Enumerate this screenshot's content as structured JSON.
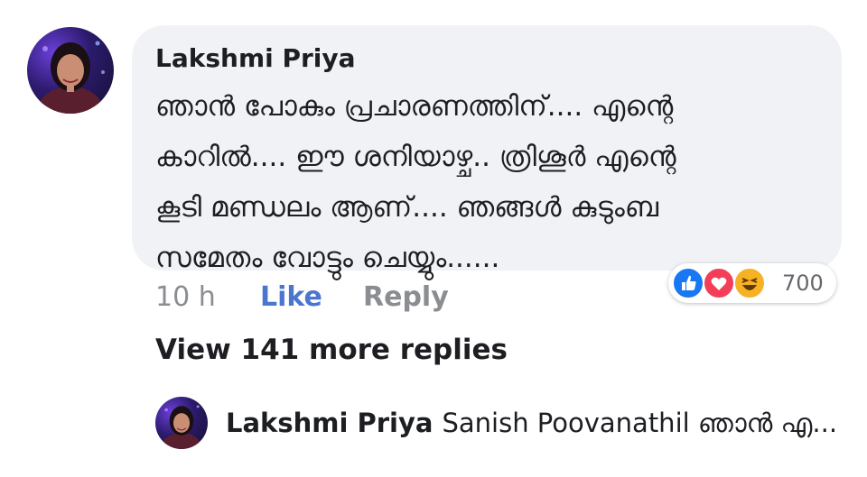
{
  "comment": {
    "author": "Lakshmi Priya",
    "lines": [
      "ഞാൻ പോകും പ്രചാരണത്തിന്.... എന്റെ",
      "കാറിൽ.... ഈ ശനിയാഴ്ച.. ത്രിശൂർ എന്റെ",
      "കൂടി മണ്ഡലം ആണ്.... ഞങ്ങൾ കുടുംബ",
      "സമേതം വോട്ടും ചെയ്യും......"
    ],
    "time": "10 h",
    "like_label": "Like",
    "reply_label": "Reply",
    "reactions": {
      "icons": [
        "like-icon",
        "love-icon",
        "haha-icon"
      ],
      "count": "700",
      "colors": {
        "like": "#1877f2",
        "love": "#f33e58",
        "haha": "#f7b125"
      }
    }
  },
  "view_more": "View 141 more replies",
  "latest_reply": {
    "author": "Lakshmi Priya",
    "text": "Sanish Poovanathil ഞാൻ എ..."
  },
  "colors": {
    "bubble": "#f0f2f5",
    "link_blue": "#4a76cf",
    "muted": "#8a8d91"
  }
}
